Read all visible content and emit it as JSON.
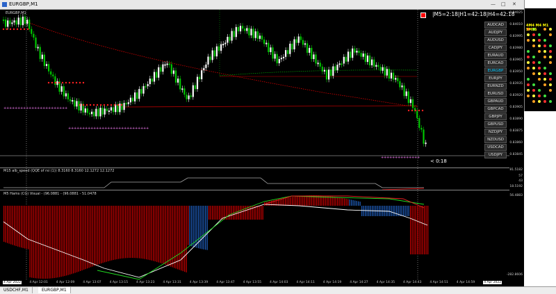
{
  "window": {
    "title": "EURGBP,M1"
  },
  "chart": {
    "title": "EURGBP,M1"
  },
  "timeframes": "|M5=2:18|H1=42:18|H4=42:18",
  "countdown": "< 0:18",
  "pairs": [
    "AUDCAD",
    "AUDJPY",
    "AUDUSD",
    "CADJPY",
    "EURAUD",
    "EURCAD",
    "EURGBP",
    "EURJPY",
    "EURNZD",
    "EURUSD",
    "GBPAUD",
    "GBPCAD",
    "GBPJPY",
    "GBPUSD",
    "NZDJPY",
    "NZDUSD",
    "USDCAD",
    "USDJPY"
  ],
  "selected_pair": "EURGBP",
  "price_scale": [
    "0.84025",
    "0.84010",
    "0.83995",
    "0.83980",
    "0.83965",
    "0.83950",
    "0.83935",
    "0.83920",
    "0.83905",
    "0.83890",
    "0.83875",
    "0.83860",
    "0.83845"
  ],
  "indicator1": {
    "label": "M15 alb_speed (QQE of rsi (1)) 8.3160 8.3160 12.1272 12.1272",
    "scale": [
      "81.5182",
      "57",
      "43",
      "18.5192"
    ]
  },
  "indicator2": {
    "label": "M5 Hams (CG) Visual - (96.0881 - (96.0881 - 51.0478",
    "scale": [
      "56.4883",
      "-282.8606"
    ]
  },
  "time_labels": [
    "4 Apr 2022",
    "4 Apr 12:01",
    "4 Apr 12:09",
    "4 Apr 13:07",
    "4 Apr 13:15",
    "4 Apr 13:23",
    "4 Apr 13:31",
    "4 Apr 13:39",
    "4 Apr 13:47",
    "4 Apr 13:55",
    "4 Apr 14:03",
    "4 Apr 14:11",
    "4 Apr 14:19",
    "4 Apr 14:27",
    "4 Apr 14:35",
    "4 Apr 14:43",
    "4 Apr 14:51",
    "4 Apr 14:59",
    "4 Apr 2022"
  ],
  "tabs": [
    "USDCHF,M1",
    "EURGBP,M1"
  ],
  "active_tab": "EURGBP,M1",
  "side": {
    "title": "",
    "head": "4M4 M4 M1 5M5S"
  },
  "colors": {
    "bull": "#ffffff",
    "bull_alt": "#00ff00",
    "bear": "#00c800",
    "dots_red": "#ff2020",
    "dots_pink": "#ff80ff",
    "band_red": "#c00000",
    "band_blue": "#1e5ab4"
  }
}
